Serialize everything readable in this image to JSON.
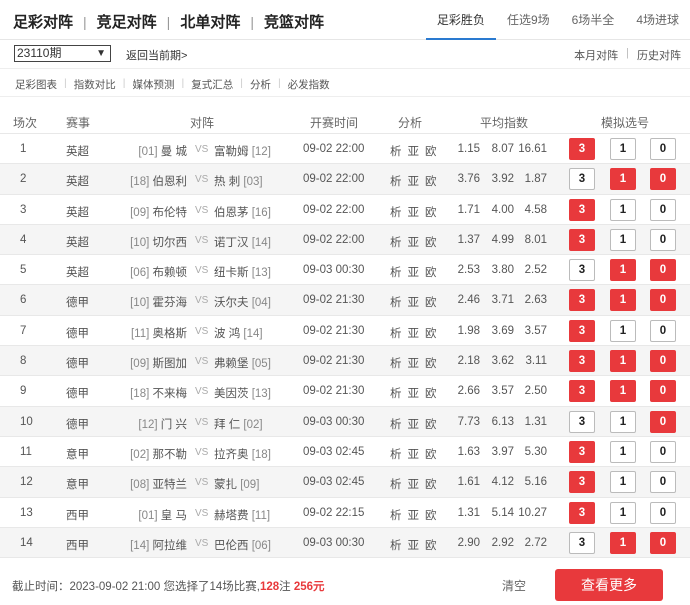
{
  "nav": {
    "main_tabs": [
      "足彩对阵",
      "竞足对阵",
      "北单对阵",
      "竞篮对阵"
    ],
    "sub_tabs": [
      "足彩胜负",
      "任选9场",
      "6场半全",
      "4场进球"
    ]
  },
  "period": {
    "selected": "23110期",
    "back_label": "返回当前期>"
  },
  "right_links": [
    "本月对阵",
    "历史对阵"
  ],
  "tools": [
    "足彩图表",
    "指数对比",
    "媒体预测",
    "复式汇总",
    "分析",
    "必发指数"
  ],
  "headers": {
    "index": "场次",
    "league": "赛事",
    "match": "对阵",
    "time": "开赛时间",
    "analysis": "分析",
    "odds": "平均指数",
    "picks": "模拟选号"
  },
  "analysis_labels": [
    "析",
    "亚",
    "欧"
  ],
  "vs_label": "VS",
  "matches": [
    {
      "no": "1",
      "league": "英超",
      "home_rank": "[01]",
      "home": "曼 城",
      "away": "富勒姆",
      "away_rank": "[12]",
      "time": "09-02 22:00",
      "odds": [
        "1.15",
        "8.07",
        "16.61"
      ],
      "picks": [
        true,
        false,
        false
      ]
    },
    {
      "no": "2",
      "league": "英超",
      "home_rank": "[18]",
      "home": "伯恩利",
      "away": "热 刺",
      "away_rank": "[03]",
      "time": "09-02 22:00",
      "odds": [
        "3.76",
        "3.92",
        "1.87"
      ],
      "picks": [
        false,
        true,
        true
      ]
    },
    {
      "no": "3",
      "league": "英超",
      "home_rank": "[09]",
      "home": "布伦特",
      "away": "伯恩茅",
      "away_rank": "[16]",
      "time": "09-02 22:00",
      "odds": [
        "1.71",
        "4.00",
        "4.58"
      ],
      "picks": [
        true,
        false,
        false
      ]
    },
    {
      "no": "4",
      "league": "英超",
      "home_rank": "[10]",
      "home": "切尔西",
      "away": "诺丁汉",
      "away_rank": "[14]",
      "time": "09-02 22:00",
      "odds": [
        "1.37",
        "4.99",
        "8.01"
      ],
      "picks": [
        true,
        false,
        false
      ]
    },
    {
      "no": "5",
      "league": "英超",
      "home_rank": "[06]",
      "home": "布赖顿",
      "away": "纽卡斯",
      "away_rank": "[13]",
      "time": "09-03 00:30",
      "odds": [
        "2.53",
        "3.80",
        "2.52"
      ],
      "picks": [
        false,
        true,
        true
      ]
    },
    {
      "no": "6",
      "league": "德甲",
      "home_rank": "[10]",
      "home": "霍芬海",
      "away": "沃尔夫",
      "away_rank": "[04]",
      "time": "09-02 21:30",
      "odds": [
        "2.46",
        "3.71",
        "2.63"
      ],
      "picks": [
        true,
        true,
        true
      ]
    },
    {
      "no": "7",
      "league": "德甲",
      "home_rank": "[11]",
      "home": "奥格斯",
      "away": "波 鸿",
      "away_rank": "[14]",
      "time": "09-02 21:30",
      "odds": [
        "1.98",
        "3.69",
        "3.57"
      ],
      "picks": [
        true,
        false,
        false
      ]
    },
    {
      "no": "8",
      "league": "德甲",
      "home_rank": "[09]",
      "home": "斯图加",
      "away": "弗赖堡",
      "away_rank": "[05]",
      "time": "09-02 21:30",
      "odds": [
        "2.18",
        "3.62",
        "3.11"
      ],
      "picks": [
        true,
        true,
        true
      ]
    },
    {
      "no": "9",
      "league": "德甲",
      "home_rank": "[18]",
      "home": "不来梅",
      "away": "美因茨",
      "away_rank": "[13]",
      "time": "09-02 21:30",
      "odds": [
        "2.66",
        "3.57",
        "2.50"
      ],
      "picks": [
        true,
        true,
        true
      ]
    },
    {
      "no": "10",
      "league": "德甲",
      "home_rank": "[12]",
      "home": "门 兴",
      "away": "拜 仁",
      "away_rank": "[02]",
      "time": "09-03 00:30",
      "odds": [
        "7.73",
        "6.13",
        "1.31"
      ],
      "picks": [
        false,
        false,
        true
      ]
    },
    {
      "no": "11",
      "league": "意甲",
      "home_rank": "[02]",
      "home": "那不勒",
      "away": "拉齐奥",
      "away_rank": "[18]",
      "time": "09-03 02:45",
      "odds": [
        "1.63",
        "3.97",
        "5.30"
      ],
      "picks": [
        true,
        false,
        false
      ]
    },
    {
      "no": "12",
      "league": "意甲",
      "home_rank": "[08]",
      "home": "亚特兰",
      "away": "蒙扎",
      "away_rank": "[09]",
      "time": "09-03 02:45",
      "odds": [
        "1.61",
        "4.12",
        "5.16"
      ],
      "picks": [
        true,
        false,
        false
      ]
    },
    {
      "no": "13",
      "league": "西甲",
      "home_rank": "[01]",
      "home": "皇 马",
      "away": "赫塔费",
      "away_rank": "[11]",
      "time": "09-02 22:15",
      "odds": [
        "1.31",
        "5.14",
        "10.27"
      ],
      "picks": [
        true,
        false,
        false
      ]
    },
    {
      "no": "14",
      "league": "西甲",
      "home_rank": "[14]",
      "home": "阿拉维",
      "away": "巴伦西",
      "away_rank": "[06]",
      "time": "09-03 00:30",
      "odds": [
        "2.90",
        "2.92",
        "2.72"
      ],
      "picks": [
        false,
        true,
        true
      ]
    }
  ],
  "footer": {
    "prefix": "截止时间：2023-09-02 21:00 您选择了14场比赛,",
    "bets": "128",
    "bets_suffix": "注",
    "amount": "256元",
    "clear_label": "清空",
    "more_label": "查看更多"
  },
  "colors": {
    "accent": "#e8393c",
    "active_tab": "#2a7ad0"
  }
}
